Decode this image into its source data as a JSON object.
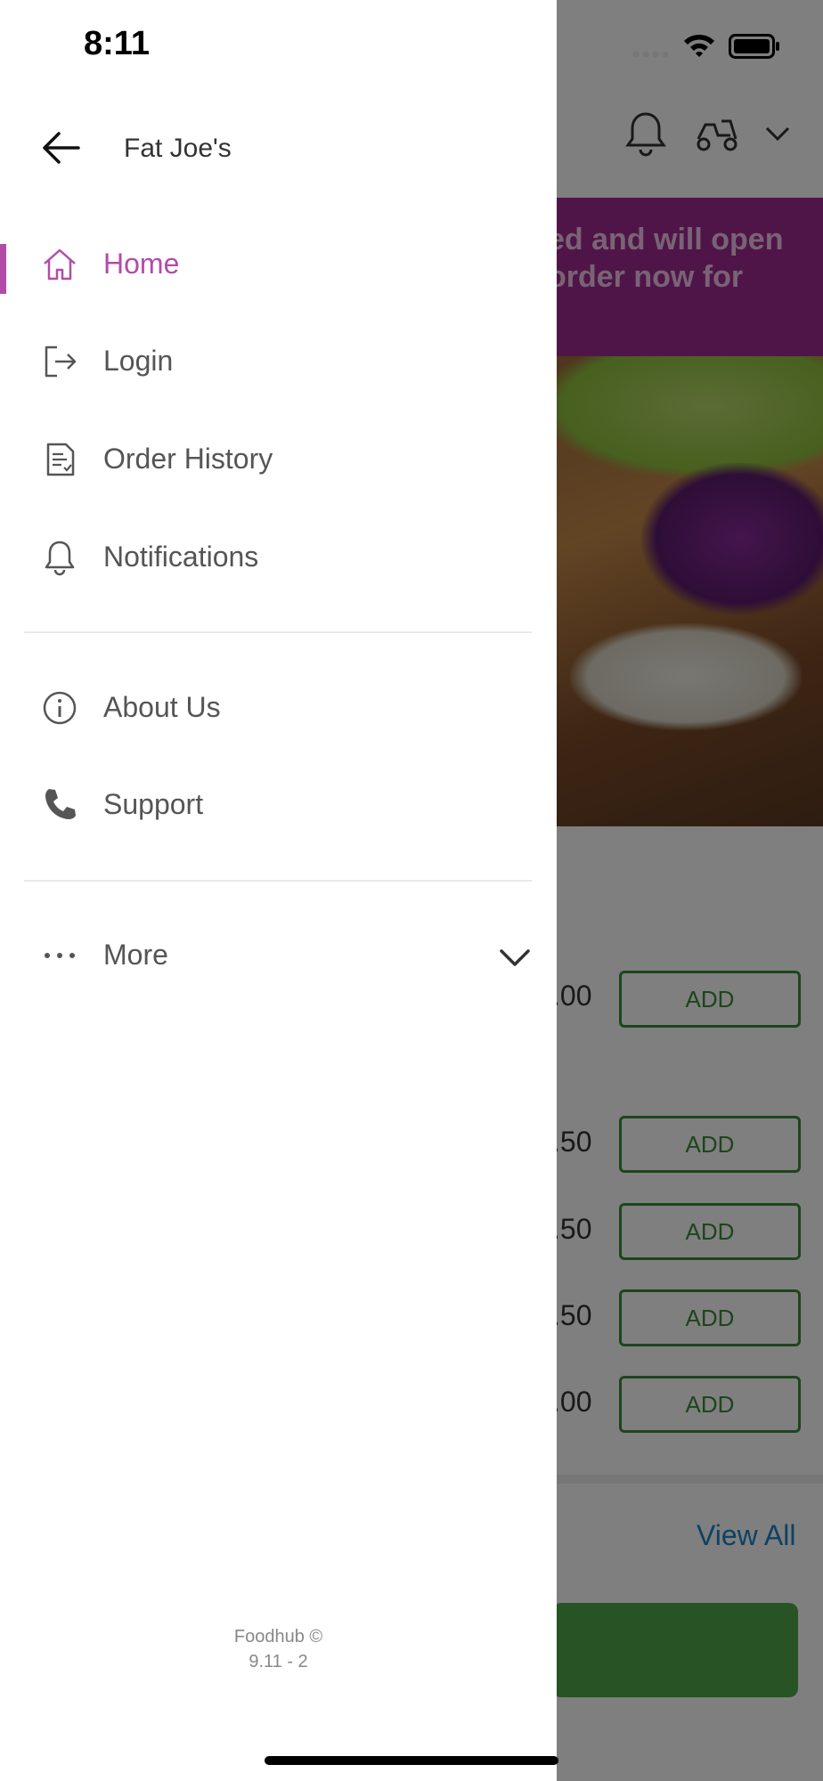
{
  "status_bar": {
    "time": "8:11"
  },
  "background": {
    "banner_text_line1": "ed and will open",
    "banner_text_line2": "order now for",
    "menu_rows": [
      {
        "price": ".00",
        "add_label": "ADD"
      },
      {
        "price": ".50",
        "add_label": "ADD"
      },
      {
        "price": ".50",
        "add_label": "ADD"
      },
      {
        "price": ".50",
        "add_label": "ADD"
      },
      {
        "price": ".00",
        "add_label": "ADD"
      }
    ],
    "view_all_label": "View All",
    "colors": {
      "banner": "#a12a91",
      "add_button": "#3d8a3a",
      "cta": "#4ea74a",
      "link": "#1a84c6"
    }
  },
  "drawer": {
    "store_name": "Fat Joe's",
    "menu_items": [
      {
        "label": "Home",
        "icon": "home-icon",
        "active": true
      },
      {
        "label": "Login",
        "icon": "login-icon",
        "active": false
      },
      {
        "label": "Order History",
        "icon": "order-history-icon",
        "active": false
      },
      {
        "label": "Notifications",
        "icon": "bell-icon",
        "active": false
      },
      {
        "label": "About Us",
        "icon": "info-icon",
        "active": false
      },
      {
        "label": "Support",
        "icon": "phone-icon",
        "active": false
      },
      {
        "label": "More",
        "icon": "more-dots-icon",
        "active": false
      }
    ],
    "footer": {
      "brand": "Foodhub ©",
      "version": "9.11 - 2"
    },
    "colors": {
      "accent": "#b24ca8",
      "text": "#555555"
    }
  }
}
